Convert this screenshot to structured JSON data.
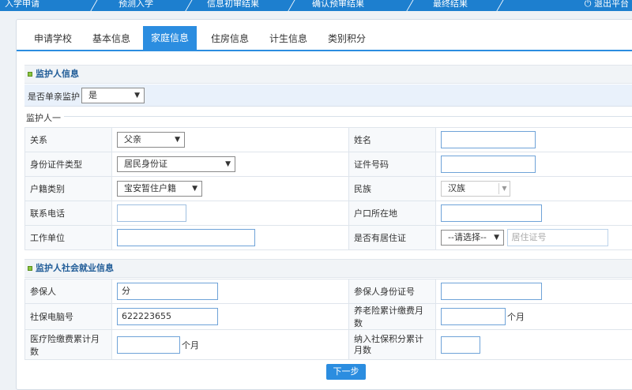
{
  "topbar": {
    "steps": [
      "入学申请",
      "预测入学",
      "信息初审结果",
      "确认预审结果",
      "最终结果"
    ],
    "logout": "退出平台"
  },
  "tabs": [
    {
      "label": "申请学校",
      "active": false
    },
    {
      "label": "基本信息",
      "active": false
    },
    {
      "label": "家庭信息",
      "active": true
    },
    {
      "label": "住房信息",
      "active": false
    },
    {
      "label": "计生信息",
      "active": false
    },
    {
      "label": "类别积分",
      "active": false
    }
  ],
  "guardian_section": {
    "title": "监护人信息",
    "single_parent_label": "是否单亲监护",
    "single_parent_value": "是",
    "sub_legend": "监护人一",
    "relation_label": "关系",
    "relation_value": "父亲",
    "name_label": "姓名",
    "name_value": "",
    "id_type_label": "身份证件类型",
    "id_type_value": "居民身份证",
    "id_no_label": "证件号码",
    "id_no_value": "",
    "household_label": "户籍类别",
    "household_value": "宝安暂住户籍",
    "ethnicity_label": "民族",
    "ethnicity_value": "汉族",
    "phone_label": "联系电话",
    "phone_value": "",
    "hukou_label": "户口所在地",
    "hukou_value": "",
    "employer_label": "工作单位",
    "employer_value": "",
    "residence_label": "是否有居住证",
    "residence_value": "--请选择--",
    "residence_no_placeholder": "居住证号"
  },
  "social_section": {
    "title": "监护人社会就业信息",
    "insured_label": "参保人",
    "insured_value": "分",
    "insured_id_label": "参保人身份证号",
    "insured_id_value": "",
    "ss_no_label": "社保电脑号",
    "ss_no_value": "622223655",
    "pension_label": "养老险累计缴费月数",
    "pension_value": "",
    "pension_unit": "个月",
    "medical_label": "医疗险缴费累计月数",
    "medical_value": "",
    "medical_unit": "个月",
    "points_label": "纳入社保积分累计月数",
    "points_value": ""
  },
  "next_button": "下一步"
}
